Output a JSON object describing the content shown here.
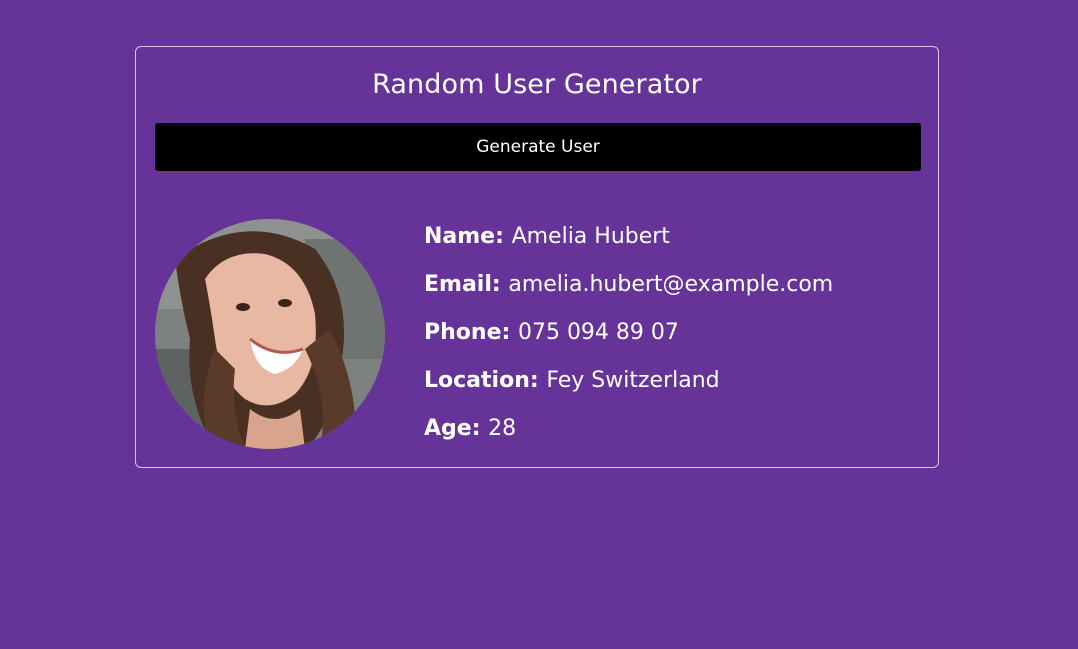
{
  "app": {
    "title": "Random User Generator"
  },
  "actions": {
    "generate_label": "Generate User"
  },
  "user": {
    "fields": [
      {
        "label": "Name:",
        "value": "Amelia Hubert"
      },
      {
        "label": "Email:",
        "value": "amelia.hubert@example.com"
      },
      {
        "label": "Phone:",
        "value": "075 094 89 07"
      },
      {
        "label": "Location:",
        "value": "Fey Switzerland"
      },
      {
        "label": "Age:",
        "value": "28"
      }
    ],
    "avatar_icon": "user-photo"
  },
  "colors": {
    "background": "#663399",
    "button_bg": "#000000",
    "text": "#ffffff",
    "card_border": "#d9c9ec"
  }
}
